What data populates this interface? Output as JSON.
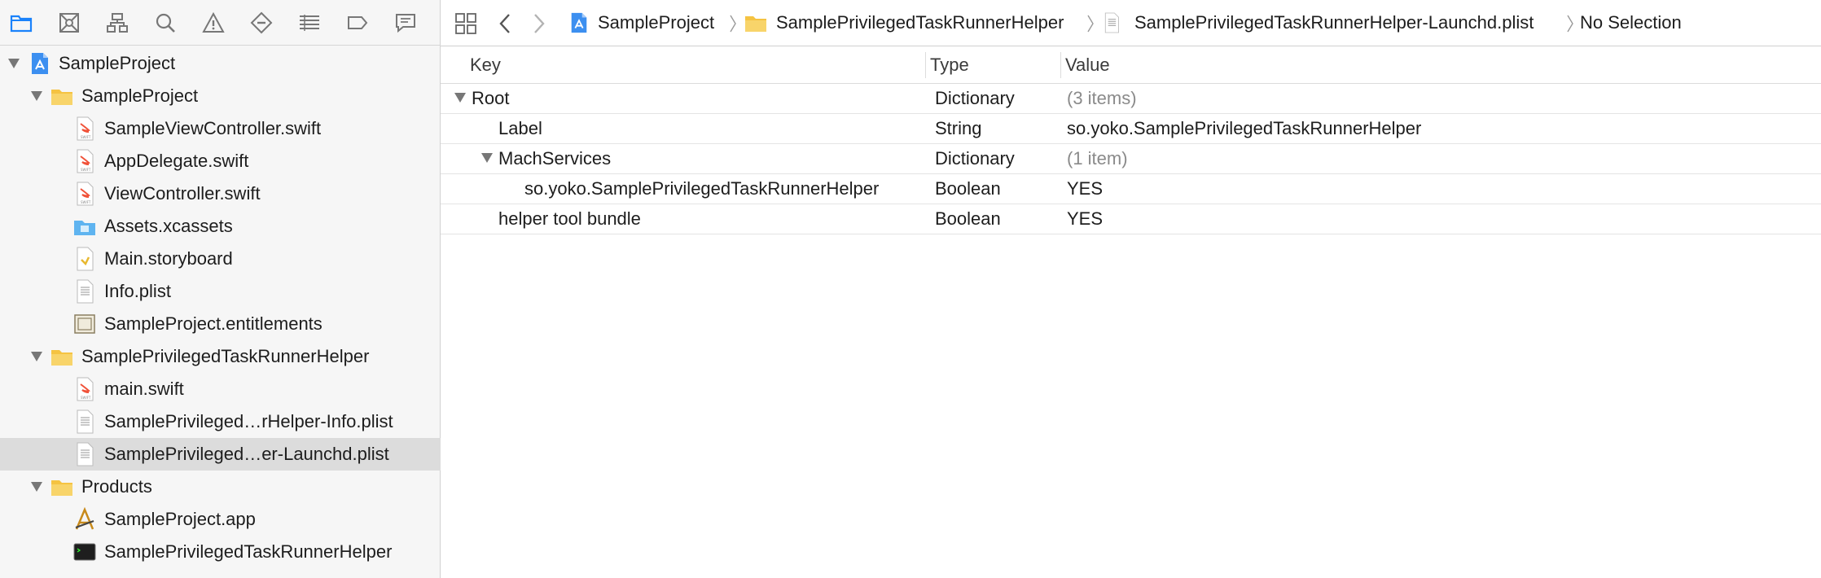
{
  "navigator": {
    "toolbar_icons": [
      "folder-icon",
      "source-control-icon",
      "hierarchy-icon",
      "search-icon",
      "warning-icon",
      "breakpoint-diamond-icon",
      "list-icon",
      "tag-icon",
      "message-icon"
    ],
    "tree": [
      {
        "label": "SampleProject",
        "icon": "xcode-project-icon",
        "expanded": true
      },
      {
        "label": "SampleProject",
        "icon": "folder-icon",
        "expanded": true
      },
      {
        "label": "SampleViewController.swift",
        "icon": "swift-file-icon"
      },
      {
        "label": "AppDelegate.swift",
        "icon": "swift-file-icon"
      },
      {
        "label": "ViewController.swift",
        "icon": "swift-file-icon"
      },
      {
        "label": "Assets.xcassets",
        "icon": "asset-catalog-icon"
      },
      {
        "label": "Main.storyboard",
        "icon": "storyboard-icon"
      },
      {
        "label": "Info.plist",
        "icon": "plist-file-icon"
      },
      {
        "label": "SampleProject.entitlements",
        "icon": "entitlements-icon"
      },
      {
        "label": "SamplePrivilegedTaskRunnerHelper",
        "icon": "folder-icon",
        "expanded": true
      },
      {
        "label": "main.swift",
        "icon": "swift-file-icon"
      },
      {
        "label": "SamplePrivileged…rHelper-Info.plist",
        "icon": "plist-file-icon"
      },
      {
        "label": "SamplePrivileged…er-Launchd.plist",
        "icon": "plist-file-icon",
        "selected": true
      },
      {
        "label": "Products",
        "icon": "folder-icon",
        "expanded": true
      },
      {
        "label": "SampleProject.app",
        "icon": "app-icon"
      },
      {
        "label": "SamplePrivilegedTaskRunnerHelper",
        "icon": "terminal-icon"
      }
    ]
  },
  "jumpbar": {
    "crumbs": [
      {
        "label": "SampleProject",
        "icon": "xcode-project-icon"
      },
      {
        "label": "SamplePrivilegedTaskRunnerHelper",
        "icon": "folder-icon"
      },
      {
        "label": "SamplePrivilegedTaskRunnerHelper-Launchd.plist",
        "icon": "plist-file-icon"
      },
      {
        "label": "No Selection",
        "icon": ""
      }
    ]
  },
  "plist": {
    "headers": {
      "key": "Key",
      "type": "Type",
      "value": "Value"
    },
    "rows": [
      {
        "key": "Root",
        "type": "Dictionary",
        "value": "(3 items)",
        "muted": true,
        "disclosure": true
      },
      {
        "key": "Label",
        "type": "String",
        "value": "so.yoko.SamplePrivilegedTaskRunnerHelper"
      },
      {
        "key": "MachServices",
        "type": "Dictionary",
        "value": "(1 item)",
        "muted": true,
        "disclosure": true
      },
      {
        "key": "so.yoko.SamplePrivilegedTaskRunnerHelper",
        "type": "Boolean",
        "value": "YES"
      },
      {
        "key": "helper tool bundle",
        "type": "Boolean",
        "value": "YES"
      }
    ]
  },
  "colors": {
    "accent": "#1a82fb",
    "folder": "#f5c342",
    "selection": "#dcdcdc"
  }
}
